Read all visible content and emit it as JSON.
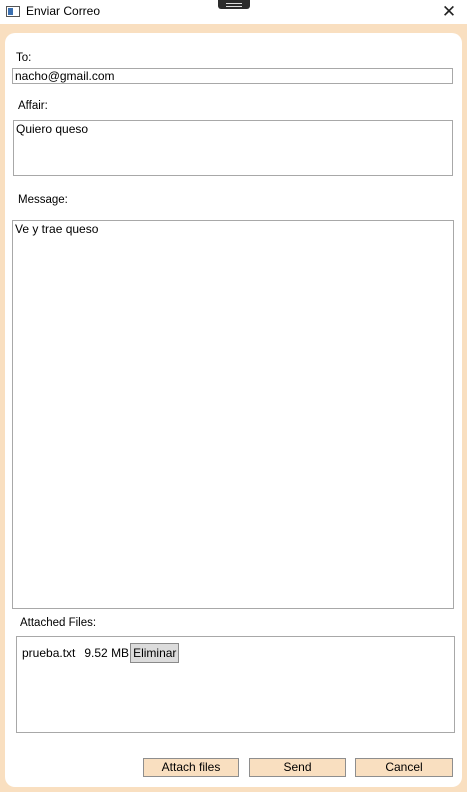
{
  "window": {
    "title": "Enviar Correo",
    "close_glyph": "✕"
  },
  "form": {
    "to_label": "To:",
    "to_value": "nacho@gmail.com",
    "affair_label": "Affair:",
    "affair_value": "Quiero queso",
    "message_label": "Message:",
    "message_value": "Ve y trae queso",
    "attached_label": "Attached Files:"
  },
  "attachments": [
    {
      "name": "prueba.txt",
      "size": "9.52 MB",
      "remove_label": "Eliminar"
    }
  ],
  "buttons": {
    "attach": "Attach files",
    "send": "Send",
    "cancel": "Cancel"
  },
  "colors": {
    "accent": "#f9dfc0",
    "border": "#a8a8a8"
  }
}
